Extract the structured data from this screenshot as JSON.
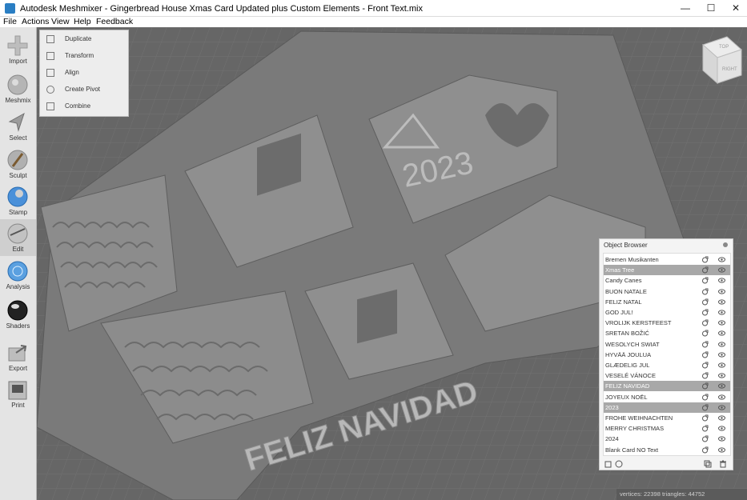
{
  "window": {
    "title": "Autodesk Meshmixer - Gingerbread House Xmas Card Updated plus Custom Elements - Front Text.mix",
    "minimize": "—",
    "maximize": "☐",
    "close": "✕"
  },
  "menu": [
    "File",
    "Actions",
    "View",
    "Help",
    "Feedback"
  ],
  "tools": [
    {
      "label": "Import",
      "icon": "import-icon"
    },
    {
      "label": "Meshmix",
      "icon": "meshmix-icon"
    },
    {
      "label": "Select",
      "icon": "select-icon"
    },
    {
      "label": "Sculpt",
      "icon": "sculpt-icon"
    },
    {
      "label": "Stamp",
      "icon": "stamp-icon"
    },
    {
      "label": "Edit",
      "icon": "edit-icon"
    },
    {
      "label": "Analysis",
      "icon": "analysis-icon"
    },
    {
      "label": "Shaders",
      "icon": "shaders-icon"
    },
    {
      "label": "Export",
      "icon": "export-icon"
    },
    {
      "label": "Print",
      "icon": "print-icon"
    }
  ],
  "edit_menu": [
    "Duplicate",
    "Transform",
    "Align",
    "Create Pivot",
    "Combine"
  ],
  "scene": {
    "year": "2023",
    "banner": "FELIZ NAVIDAD"
  },
  "view_cube": {
    "top": "TOP",
    "right": "RIGHT"
  },
  "object_browser": {
    "title": "Object Browser",
    "items": [
      {
        "name": "Bremen Musikanten",
        "selected": false
      },
      {
        "name": "Xmas Tree",
        "selected": true
      },
      {
        "name": "Candy Canes",
        "selected": false
      },
      {
        "name": "BUON NATALE",
        "selected": false
      },
      {
        "name": "FELIZ NATAL",
        "selected": false
      },
      {
        "name": "GOD JUL!",
        "selected": false
      },
      {
        "name": "VROLIJK KERSTFEEST",
        "selected": false
      },
      {
        "name": "SRETAN BOŽIĆ",
        "selected": false
      },
      {
        "name": "WESOLYCH SWIAT",
        "selected": false
      },
      {
        "name": "HYVÄÄ JOULUA",
        "selected": false
      },
      {
        "name": "GLÆDELIG JUL",
        "selected": false
      },
      {
        "name": "VESELÉ VÁNOCE",
        "selected": false
      },
      {
        "name": "FELIZ NAVIDAD",
        "selected": true
      },
      {
        "name": "JOYEUX NOËL",
        "selected": false
      },
      {
        "name": "2023",
        "selected": true
      },
      {
        "name": "FROHE WEIHNACHTEN",
        "selected": false
      },
      {
        "name": "MERRY CHRISTMAS",
        "selected": false
      },
      {
        "name": "2024",
        "selected": false
      },
      {
        "name": "Blank Card NO Text",
        "selected": false
      }
    ]
  },
  "status": "vertices: 22398 triangles: 44752",
  "colors": {
    "accent": "#2a7ec3",
    "viewport": "#6a6a6a",
    "model": "#8a8a8a",
    "selected_row": "#a8a8a8"
  }
}
